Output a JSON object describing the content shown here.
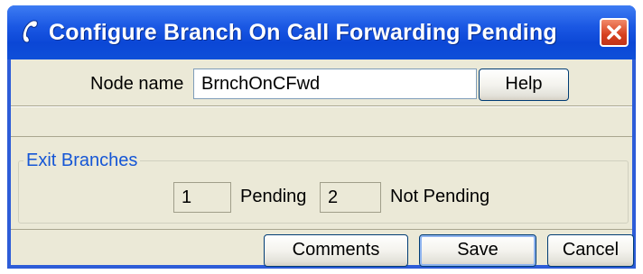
{
  "window": {
    "title": "Configure Branch On Call Forwarding Pending",
    "title_icon": "phone-handset-icon",
    "close_icon": "close-icon"
  },
  "node": {
    "label": "Node name",
    "value": "BrnchOnCFwd",
    "help_label": "Help"
  },
  "exit_branches": {
    "title": "Exit Branches",
    "items": [
      {
        "number": "1",
        "label": "Pending"
      },
      {
        "number": "2",
        "label": "Not Pending"
      }
    ]
  },
  "buttons": {
    "comments": "Comments",
    "save": "Save",
    "cancel": "Cancel"
  },
  "colors": {
    "titlebar": "#0b47d6",
    "client": "#ebe9d7",
    "group_title": "#1556d6",
    "close": "#d6401e"
  }
}
